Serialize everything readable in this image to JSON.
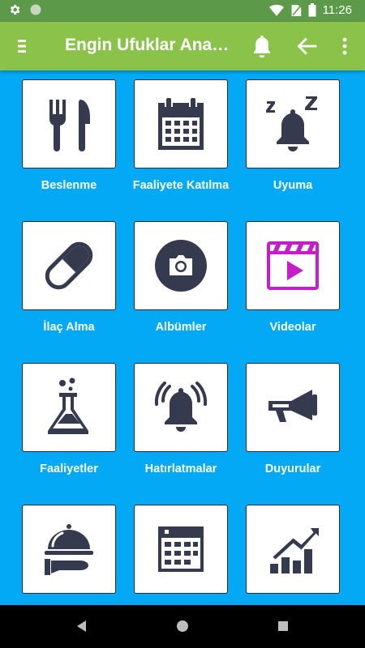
{
  "status_bar": {
    "time": "11:26",
    "icons": [
      "gear-icon",
      "circle-icon",
      "wifi-icon",
      "no-sim-icon",
      "battery-icon"
    ]
  },
  "app_bar": {
    "title": "Engin Ufuklar Anaokulu",
    "icons": [
      "menu-icon",
      "bell-icon",
      "back-arrow-icon",
      "more-vert-icon"
    ]
  },
  "tiles": [
    {
      "label": "Beslenme",
      "icon": "fork-knife-icon"
    },
    {
      "label": "Faaliyete Katılma",
      "icon": "calendar-icon"
    },
    {
      "label": "Uyuma",
      "icon": "sleeping-bell-icon"
    },
    {
      "label": "İlaç Alma",
      "icon": "pill-icon"
    },
    {
      "label": "Albümler",
      "icon": "camera-icon"
    },
    {
      "label": "Videolar",
      "icon": "video-icon"
    },
    {
      "label": "Faaliyetler",
      "icon": "flask-icon"
    },
    {
      "label": "Hatırlatmalar",
      "icon": "ringing-bell-icon"
    },
    {
      "label": "Duyurular",
      "icon": "megaphone-icon"
    },
    {
      "label": "",
      "icon": "serving-tray-icon"
    },
    {
      "label": "",
      "icon": "calendar-grid-icon"
    },
    {
      "label": "",
      "icon": "growth-chart-icon"
    }
  ],
  "colors": {
    "status_bar": "#5c9a49",
    "app_bar": "#8bc34a",
    "background": "#03a9f4",
    "icon_dark": "#363a4f",
    "icon_video": "#c51ec8"
  },
  "nav_bar": {
    "icons": [
      "back-triangle-icon",
      "home-circle-icon",
      "recents-square-icon"
    ]
  }
}
